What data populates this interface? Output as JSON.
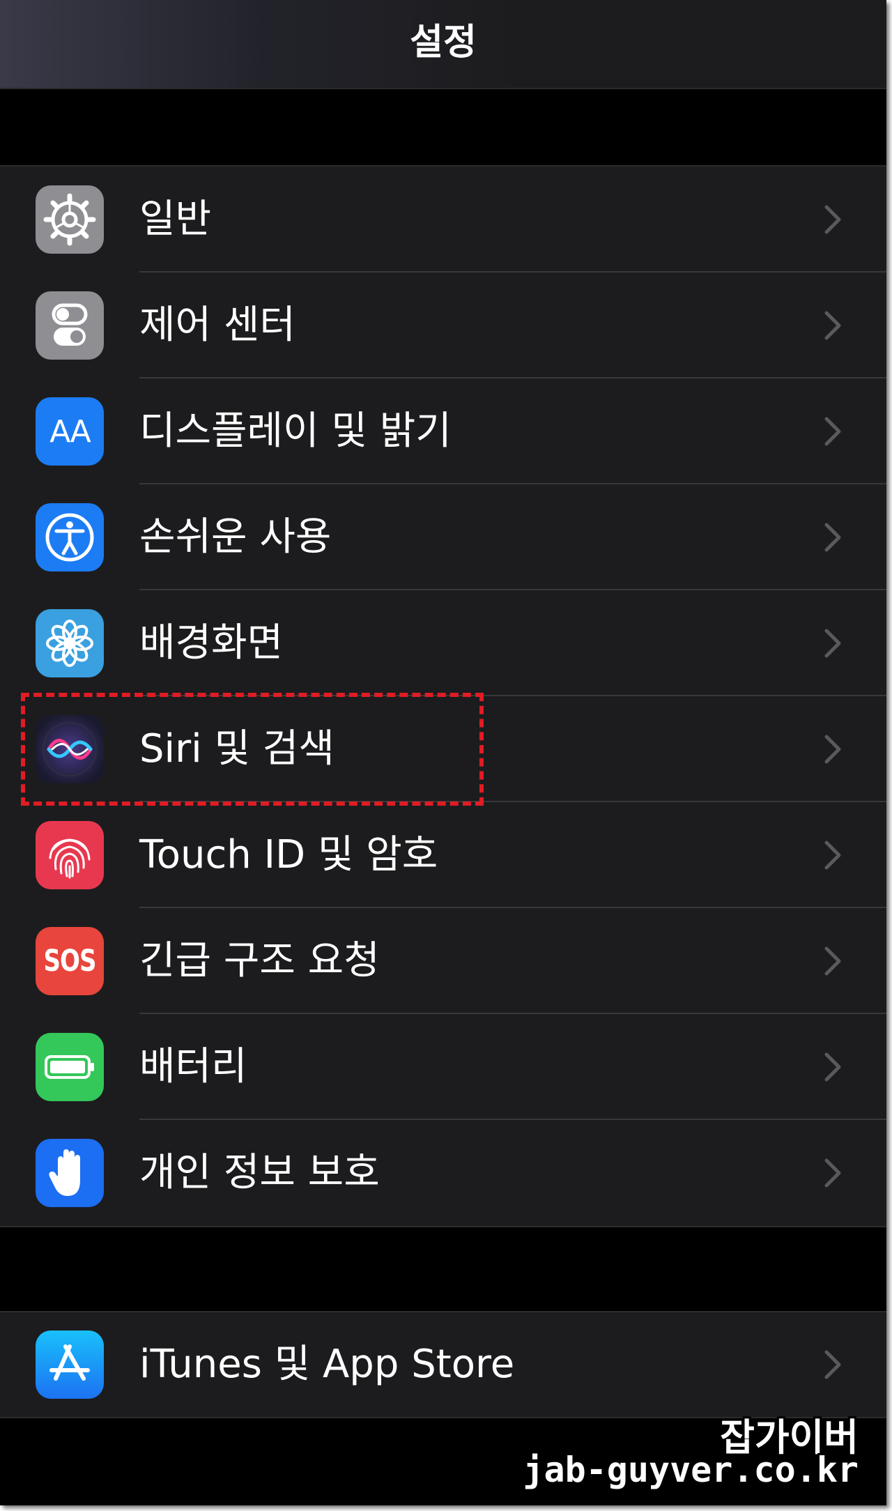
{
  "nav": {
    "title": "설정"
  },
  "group1": [
    {
      "label": "일반",
      "icon": "gear-icon",
      "color": "#8e8e93"
    },
    {
      "label": "제어 센터",
      "icon": "toggles-icon",
      "color": "#8e8e93"
    },
    {
      "label": "디스플레이 및 밝기",
      "icon": "text-size-icon",
      "color": "#1c7cf4",
      "icon_text": "AA"
    },
    {
      "label": "손쉬운 사용",
      "icon": "accessibility-icon",
      "color": "#1c7cf4"
    },
    {
      "label": "배경화면",
      "icon": "flower-icon",
      "color": "#3aa0e0"
    },
    {
      "label": "Siri 및 검색",
      "icon": "siri-icon",
      "color": "#1a1a2e"
    },
    {
      "label": "Touch ID 및 암호",
      "icon": "fingerprint-icon",
      "color": "#e8384f"
    },
    {
      "label": "긴급 구조 요청",
      "icon": "sos-icon",
      "color": "#e8453c",
      "icon_text": "SOS"
    },
    {
      "label": "배터리",
      "icon": "battery-icon",
      "color": "#34c759"
    },
    {
      "label": "개인 정보 보호",
      "icon": "hand-icon",
      "color": "#1c6ef2"
    }
  ],
  "group2": [
    {
      "label": "iTunes 및 App Store",
      "icon": "app-store-icon",
      "color": "#1c8ef4"
    }
  ],
  "watermark": {
    "line1": "잡가이버",
    "line2": "jab-guyver.co.kr"
  },
  "highlight_color": "#e01c24"
}
